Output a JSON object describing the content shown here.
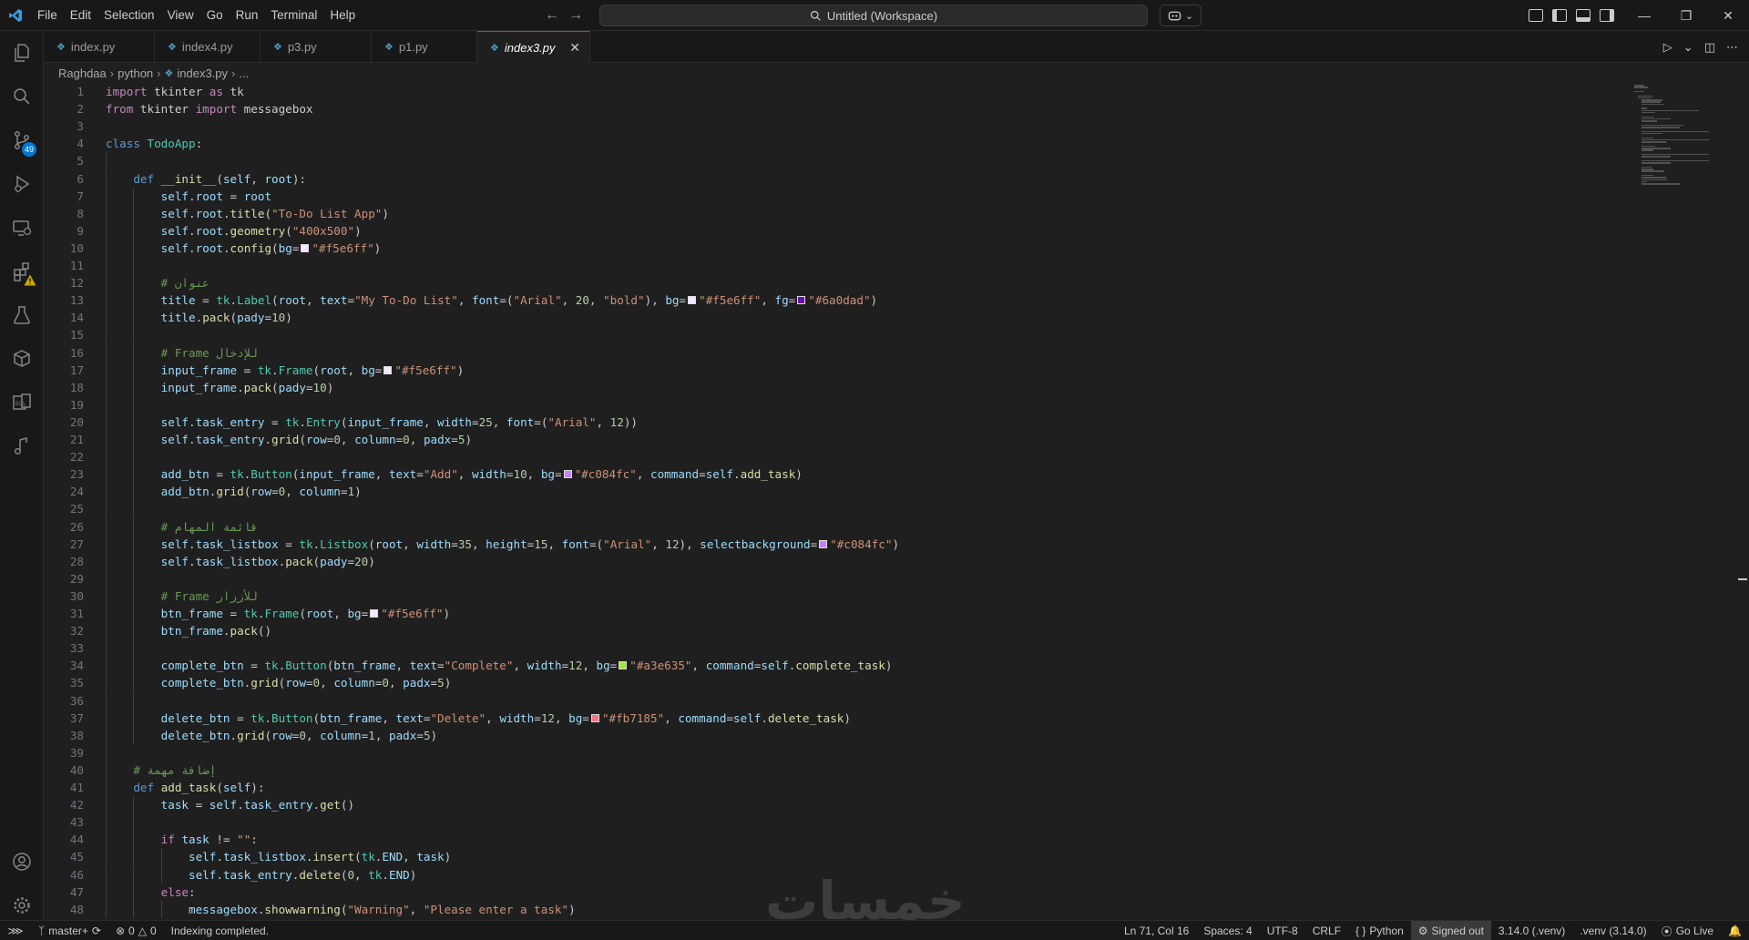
{
  "titlebar": {
    "menu": [
      "File",
      "Edit",
      "Selection",
      "View",
      "Go",
      "Run",
      "Terminal",
      "Help"
    ],
    "search_text": "Untitled (Workspace)"
  },
  "activity": {
    "source_control_badge": "49"
  },
  "tabs": [
    {
      "label": "index.py"
    },
    {
      "label": "index4.py"
    },
    {
      "label": "p3.py"
    },
    {
      "label": "p1.py"
    },
    {
      "label": "index3.py"
    }
  ],
  "breadcrumb": [
    "Raghdaa",
    "python",
    "index3.py",
    "..."
  ],
  "code_lines": [
    {
      "n": "1",
      "indent": 0,
      "html": "<span class=\"kw\">import</span> tkinter <span class=\"kw\">as</span> tk"
    },
    {
      "n": "2",
      "indent": 0,
      "html": "<span class=\"kw\">from</span> tkinter <span class=\"kw\">import</span> messagebox"
    },
    {
      "n": "3",
      "indent": 0,
      "html": ""
    },
    {
      "n": "4",
      "indent": 0,
      "html": "<span class=\"kw2\">class</span> <span class=\"cls\">TodoApp</span>:"
    },
    {
      "n": "5",
      "indent": 1,
      "html": ""
    },
    {
      "n": "6",
      "indent": 1,
      "html": "    <span class=\"kw2\">def</span> <span class=\"fn\">__init__</span>(<span class=\"var\">self</span>, <span class=\"var\">root</span>):"
    },
    {
      "n": "7",
      "indent": 2,
      "html": "        <span class=\"var\">self</span>.<span class=\"var\">root</span> = <span class=\"var\">root</span>"
    },
    {
      "n": "8",
      "indent": 2,
      "html": "        <span class=\"var\">self</span>.<span class=\"var\">root</span>.<span class=\"fn\">title</span>(<span class=\"str\">\"To-Do List App\"</span>)"
    },
    {
      "n": "9",
      "indent": 2,
      "html": "        <span class=\"var\">self</span>.<span class=\"var\">root</span>.<span class=\"fn\">geometry</span>(<span class=\"str\">\"400x500\"</span>)"
    },
    {
      "n": "10",
      "indent": 2,
      "html": "        <span class=\"var\">self</span>.<span class=\"var\">root</span>.<span class=\"fn\">config</span>(<span class=\"var\">bg</span>=<span class=\"swatch\" style=\"background:#f5e6ff\"></span><span class=\"str\">\"#f5e6ff\"</span>)"
    },
    {
      "n": "11",
      "indent": 2,
      "html": ""
    },
    {
      "n": "12",
      "indent": 2,
      "html": "        <span class=\"cmt\"># عنوان</span>"
    },
    {
      "n": "13",
      "indent": 2,
      "html": "        <span class=\"var\">title</span> = <span class=\"cls\">tk</span>.<span class=\"cls\">Label</span>(<span class=\"var\">root</span>, <span class=\"var\">text</span>=<span class=\"str\">\"My To-Do List\"</span>, <span class=\"var\">font</span>=(<span class=\"str\">\"Arial\"</span>, <span class=\"num\">20</span>, <span class=\"str\">\"bold\"</span>), <span class=\"var\">bg</span>=<span class=\"swatch\" style=\"background:#f5e6ff\"></span><span class=\"str\">\"#f5e6ff\"</span>, <span class=\"var\">fg</span>=<span class=\"swatch\" style=\"background:#6a0dad\"></span><span class=\"str\">\"#6a0dad\"</span>)"
    },
    {
      "n": "14",
      "indent": 2,
      "html": "        <span class=\"var\">title</span>.<span class=\"fn\">pack</span>(<span class=\"var\">pady</span>=<span class=\"num\">10</span>)"
    },
    {
      "n": "15",
      "indent": 2,
      "html": ""
    },
    {
      "n": "16",
      "indent": 2,
      "html": "        <span class=\"cmt\"># Frame للإدخال</span>"
    },
    {
      "n": "17",
      "indent": 2,
      "html": "        <span class=\"var\">input_frame</span> = <span class=\"cls\">tk</span>.<span class=\"cls\">Frame</span>(<span class=\"var\">root</span>, <span class=\"var\">bg</span>=<span class=\"swatch\" style=\"background:#f5e6ff\"></span><span class=\"str\">\"#f5e6ff\"</span>)"
    },
    {
      "n": "18",
      "indent": 2,
      "html": "        <span class=\"var\">input_frame</span>.<span class=\"fn\">pack</span>(<span class=\"var\">pady</span>=<span class=\"num\">10</span>)"
    },
    {
      "n": "19",
      "indent": 2,
      "html": ""
    },
    {
      "n": "20",
      "indent": 2,
      "html": "        <span class=\"var\">self</span>.<span class=\"var\">task_entry</span> = <span class=\"cls\">tk</span>.<span class=\"cls\">Entry</span>(<span class=\"var\">input_frame</span>, <span class=\"var\">width</span>=<span class=\"num\">25</span>, <span class=\"var\">font</span>=(<span class=\"str\">\"Arial\"</span>, <span class=\"num\">12</span>))"
    },
    {
      "n": "21",
      "indent": 2,
      "html": "        <span class=\"var\">self</span>.<span class=\"var\">task_entry</span>.<span class=\"fn\">grid</span>(<span class=\"var\">row</span>=<span class=\"num\">0</span>, <span class=\"var\">column</span>=<span class=\"num\">0</span>, <span class=\"var\">padx</span>=<span class=\"num\">5</span>)"
    },
    {
      "n": "22",
      "indent": 2,
      "html": ""
    },
    {
      "n": "23",
      "indent": 2,
      "html": "        <span class=\"var\">add_btn</span> = <span class=\"cls\">tk</span>.<span class=\"cls\">Button</span>(<span class=\"var\">input_frame</span>, <span class=\"var\">text</span>=<span class=\"str\">\"Add\"</span>, <span class=\"var\">width</span>=<span class=\"num\">10</span>, <span class=\"var\">bg</span>=<span class=\"swatch\" style=\"background:#c084fc\"></span><span class=\"str\">\"#c084fc\"</span>, <span class=\"var\">command</span>=<span class=\"var\">self</span>.<span class=\"fn\">add_task</span>)"
    },
    {
      "n": "24",
      "indent": 2,
      "html": "        <span class=\"var\">add_btn</span>.<span class=\"fn\">grid</span>(<span class=\"var\">row</span>=<span class=\"num\">0</span>, <span class=\"var\">column</span>=<span class=\"num\">1</span>)"
    },
    {
      "n": "25",
      "indent": 2,
      "html": ""
    },
    {
      "n": "26",
      "indent": 2,
      "html": "        <span class=\"cmt\"># قائمة المهام</span>"
    },
    {
      "n": "27",
      "indent": 2,
      "html": "        <span class=\"var\">self</span>.<span class=\"var\">task_listbox</span> = <span class=\"cls\">tk</span>.<span class=\"cls\">Listbox</span>(<span class=\"var\">root</span>, <span class=\"var\">width</span>=<span class=\"num\">35</span>, <span class=\"var\">height</span>=<span class=\"num\">15</span>, <span class=\"var\">font</span>=(<span class=\"str\">\"Arial\"</span>, <span class=\"num\">12</span>), <span class=\"var\">selectbackground</span>=<span class=\"swatch\" style=\"background:#c084fc\"></span><span class=\"str\">\"#c084fc\"</span>)"
    },
    {
      "n": "28",
      "indent": 2,
      "html": "        <span class=\"var\">self</span>.<span class=\"var\">task_listbox</span>.<span class=\"fn\">pack</span>(<span class=\"var\">pady</span>=<span class=\"num\">20</span>)"
    },
    {
      "n": "29",
      "indent": 2,
      "html": ""
    },
    {
      "n": "30",
      "indent": 2,
      "html": "        <span class=\"cmt\"># Frame للأزرار</span>"
    },
    {
      "n": "31",
      "indent": 2,
      "html": "        <span class=\"var\">btn_frame</span> = <span class=\"cls\">tk</span>.<span class=\"cls\">Frame</span>(<span class=\"var\">root</span>, <span class=\"var\">bg</span>=<span class=\"swatch\" style=\"background:#f5e6ff\"></span><span class=\"str\">\"#f5e6ff\"</span>)"
    },
    {
      "n": "32",
      "indent": 2,
      "html": "        <span class=\"var\">btn_frame</span>.<span class=\"fn\">pack</span>()"
    },
    {
      "n": "33",
      "indent": 2,
      "html": ""
    },
    {
      "n": "34",
      "indent": 2,
      "html": "        <span class=\"var\">complete_btn</span> = <span class=\"cls\">tk</span>.<span class=\"cls\">Button</span>(<span class=\"var\">btn_frame</span>, <span class=\"var\">text</span>=<span class=\"str\">\"Complete\"</span>, <span class=\"var\">width</span>=<span class=\"num\">12</span>, <span class=\"var\">bg</span>=<span class=\"swatch\" style=\"background:#a3e635\"></span><span class=\"str\">\"#a3e635\"</span>, <span class=\"var\">command</span>=<span class=\"var\">self</span>.<span class=\"fn\">complete_task</span>)"
    },
    {
      "n": "35",
      "indent": 2,
      "html": "        <span class=\"var\">complete_btn</span>.<span class=\"fn\">grid</span>(<span class=\"var\">row</span>=<span class=\"num\">0</span>, <span class=\"var\">column</span>=<span class=\"num\">0</span>, <span class=\"var\">padx</span>=<span class=\"num\">5</span>)"
    },
    {
      "n": "36",
      "indent": 2,
      "html": ""
    },
    {
      "n": "37",
      "indent": 2,
      "html": "        <span class=\"var\">delete_btn</span> = <span class=\"cls\">tk</span>.<span class=\"cls\">Button</span>(<span class=\"var\">btn_frame</span>, <span class=\"var\">text</span>=<span class=\"str\">\"Delete\"</span>, <span class=\"var\">width</span>=<span class=\"num\">12</span>, <span class=\"var\">bg</span>=<span class=\"swatch\" style=\"background:#fb7185\"></span><span class=\"str\">\"#fb7185\"</span>, <span class=\"var\">command</span>=<span class=\"var\">self</span>.<span class=\"fn\">delete_task</span>)"
    },
    {
      "n": "38",
      "indent": 2,
      "html": "        <span class=\"var\">delete_btn</span>.<span class=\"fn\">grid</span>(<span class=\"var\">row</span>=<span class=\"num\">0</span>, <span class=\"var\">column</span>=<span class=\"num\">1</span>, <span class=\"var\">padx</span>=<span class=\"num\">5</span>)"
    },
    {
      "n": "39",
      "indent": 1,
      "html": ""
    },
    {
      "n": "40",
      "indent": 1,
      "html": "    <span class=\"cmt\"># إضافة مهمة</span>"
    },
    {
      "n": "41",
      "indent": 1,
      "html": "    <span class=\"kw2\">def</span> <span class=\"fn\">add_task</span>(<span class=\"var\">self</span>):"
    },
    {
      "n": "42",
      "indent": 2,
      "html": "        <span class=\"var\">task</span> = <span class=\"var\">self</span>.<span class=\"var\">task_entry</span>.<span class=\"fn\">get</span>()"
    },
    {
      "n": "43",
      "indent": 2,
      "html": ""
    },
    {
      "n": "44",
      "indent": 2,
      "html": "        <span class=\"kw\">if</span> <span class=\"var\">task</span> != <span class=\"str\">\"\"</span>:"
    },
    {
      "n": "45",
      "indent": 3,
      "html": "            <span class=\"var\">self</span>.<span class=\"var\">task_listbox</span>.<span class=\"fn\">insert</span>(<span class=\"cls\">tk</span>.<span class=\"var\">END</span>, <span class=\"var\">task</span>)"
    },
    {
      "n": "46",
      "indent": 3,
      "html": "            <span class=\"var\">self</span>.<span class=\"var\">task_entry</span>.<span class=\"fn\">delete</span>(<span class=\"num\">0</span>, <span class=\"cls\">tk</span>.<span class=\"var\">END</span>)"
    },
    {
      "n": "47",
      "indent": 2,
      "html": "        <span class=\"kw\">else</span>:"
    },
    {
      "n": "48",
      "indent": 3,
      "html": "            <span class=\"var\">messagebox</span>.<span class=\"fn\">showwarning</span>(<span class=\"str\">\"Warning\"</span>, <span class=\"str\">\"Please enter a task\"</span>)"
    }
  ],
  "watermark": "خمسات",
  "statusbar": {
    "branch": "master+",
    "errors": "0",
    "warnings": "0",
    "message": "Indexing completed.",
    "position": "Ln 71, Col 16",
    "spaces": "Spaces: 4",
    "encoding": "UTF-8",
    "eol": "CRLF",
    "language": "Python",
    "signed": "Signed out",
    "interpreter": "3.14.0 (.venv)",
    "venv": ".venv (3.14.0)",
    "golive": "Go Live"
  }
}
